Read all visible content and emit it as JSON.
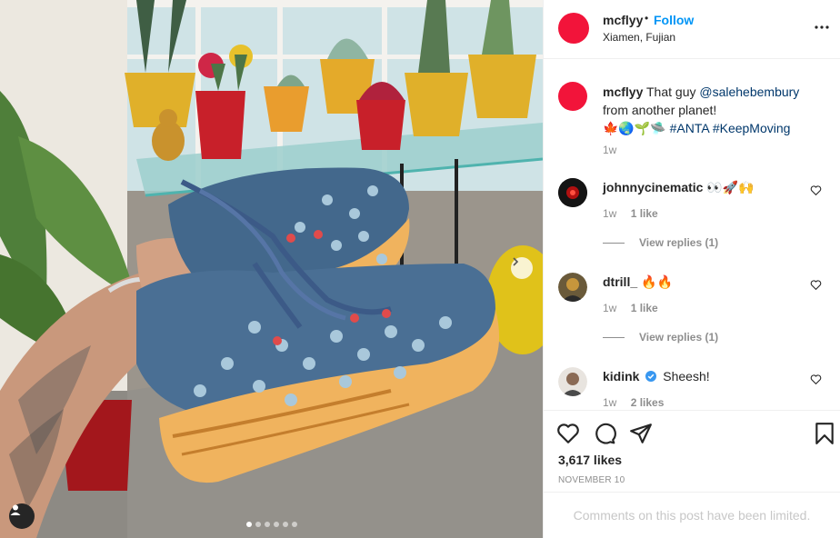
{
  "post": {
    "username": "mcflyy",
    "separator": "•",
    "follow_label": "Follow",
    "location": "Xiamen, Fujian"
  },
  "caption": {
    "username": "mcflyy",
    "text_before_mention": "That guy ",
    "mention": "@salehebembury",
    "text_after_mention": "from another planet!",
    "emoji": "🍁🌏🌱🛸",
    "hashtag1": "#ANTA",
    "hashtag2": "#KeepMoving",
    "time": "1w"
  },
  "comments": [
    {
      "username": "johnnycinematic",
      "text": "👀🚀🙌",
      "time": "1w",
      "likes": "1 like",
      "replies": "View replies (1)",
      "verified": false
    },
    {
      "username": "dtrill_",
      "text": "🔥🔥",
      "time": "1w",
      "likes": "1 like",
      "replies": "View replies (1)",
      "verified": false
    },
    {
      "username": "kidink",
      "text": "Sheesh!",
      "time": "1w",
      "likes": "2 likes",
      "verified": true
    }
  ],
  "stats": {
    "likes": "3,617 likes",
    "date": "NOVEMBER 10"
  },
  "footer": {
    "limited_text": "Comments on this post have been limited."
  },
  "carousel": {
    "count": 6,
    "active": 0
  },
  "colors": {
    "brand_avatar": "#f2143a",
    "link": "#00376b",
    "follow": "#0095f6",
    "verified": "#3897f0",
    "muted": "#8e8e8e"
  }
}
